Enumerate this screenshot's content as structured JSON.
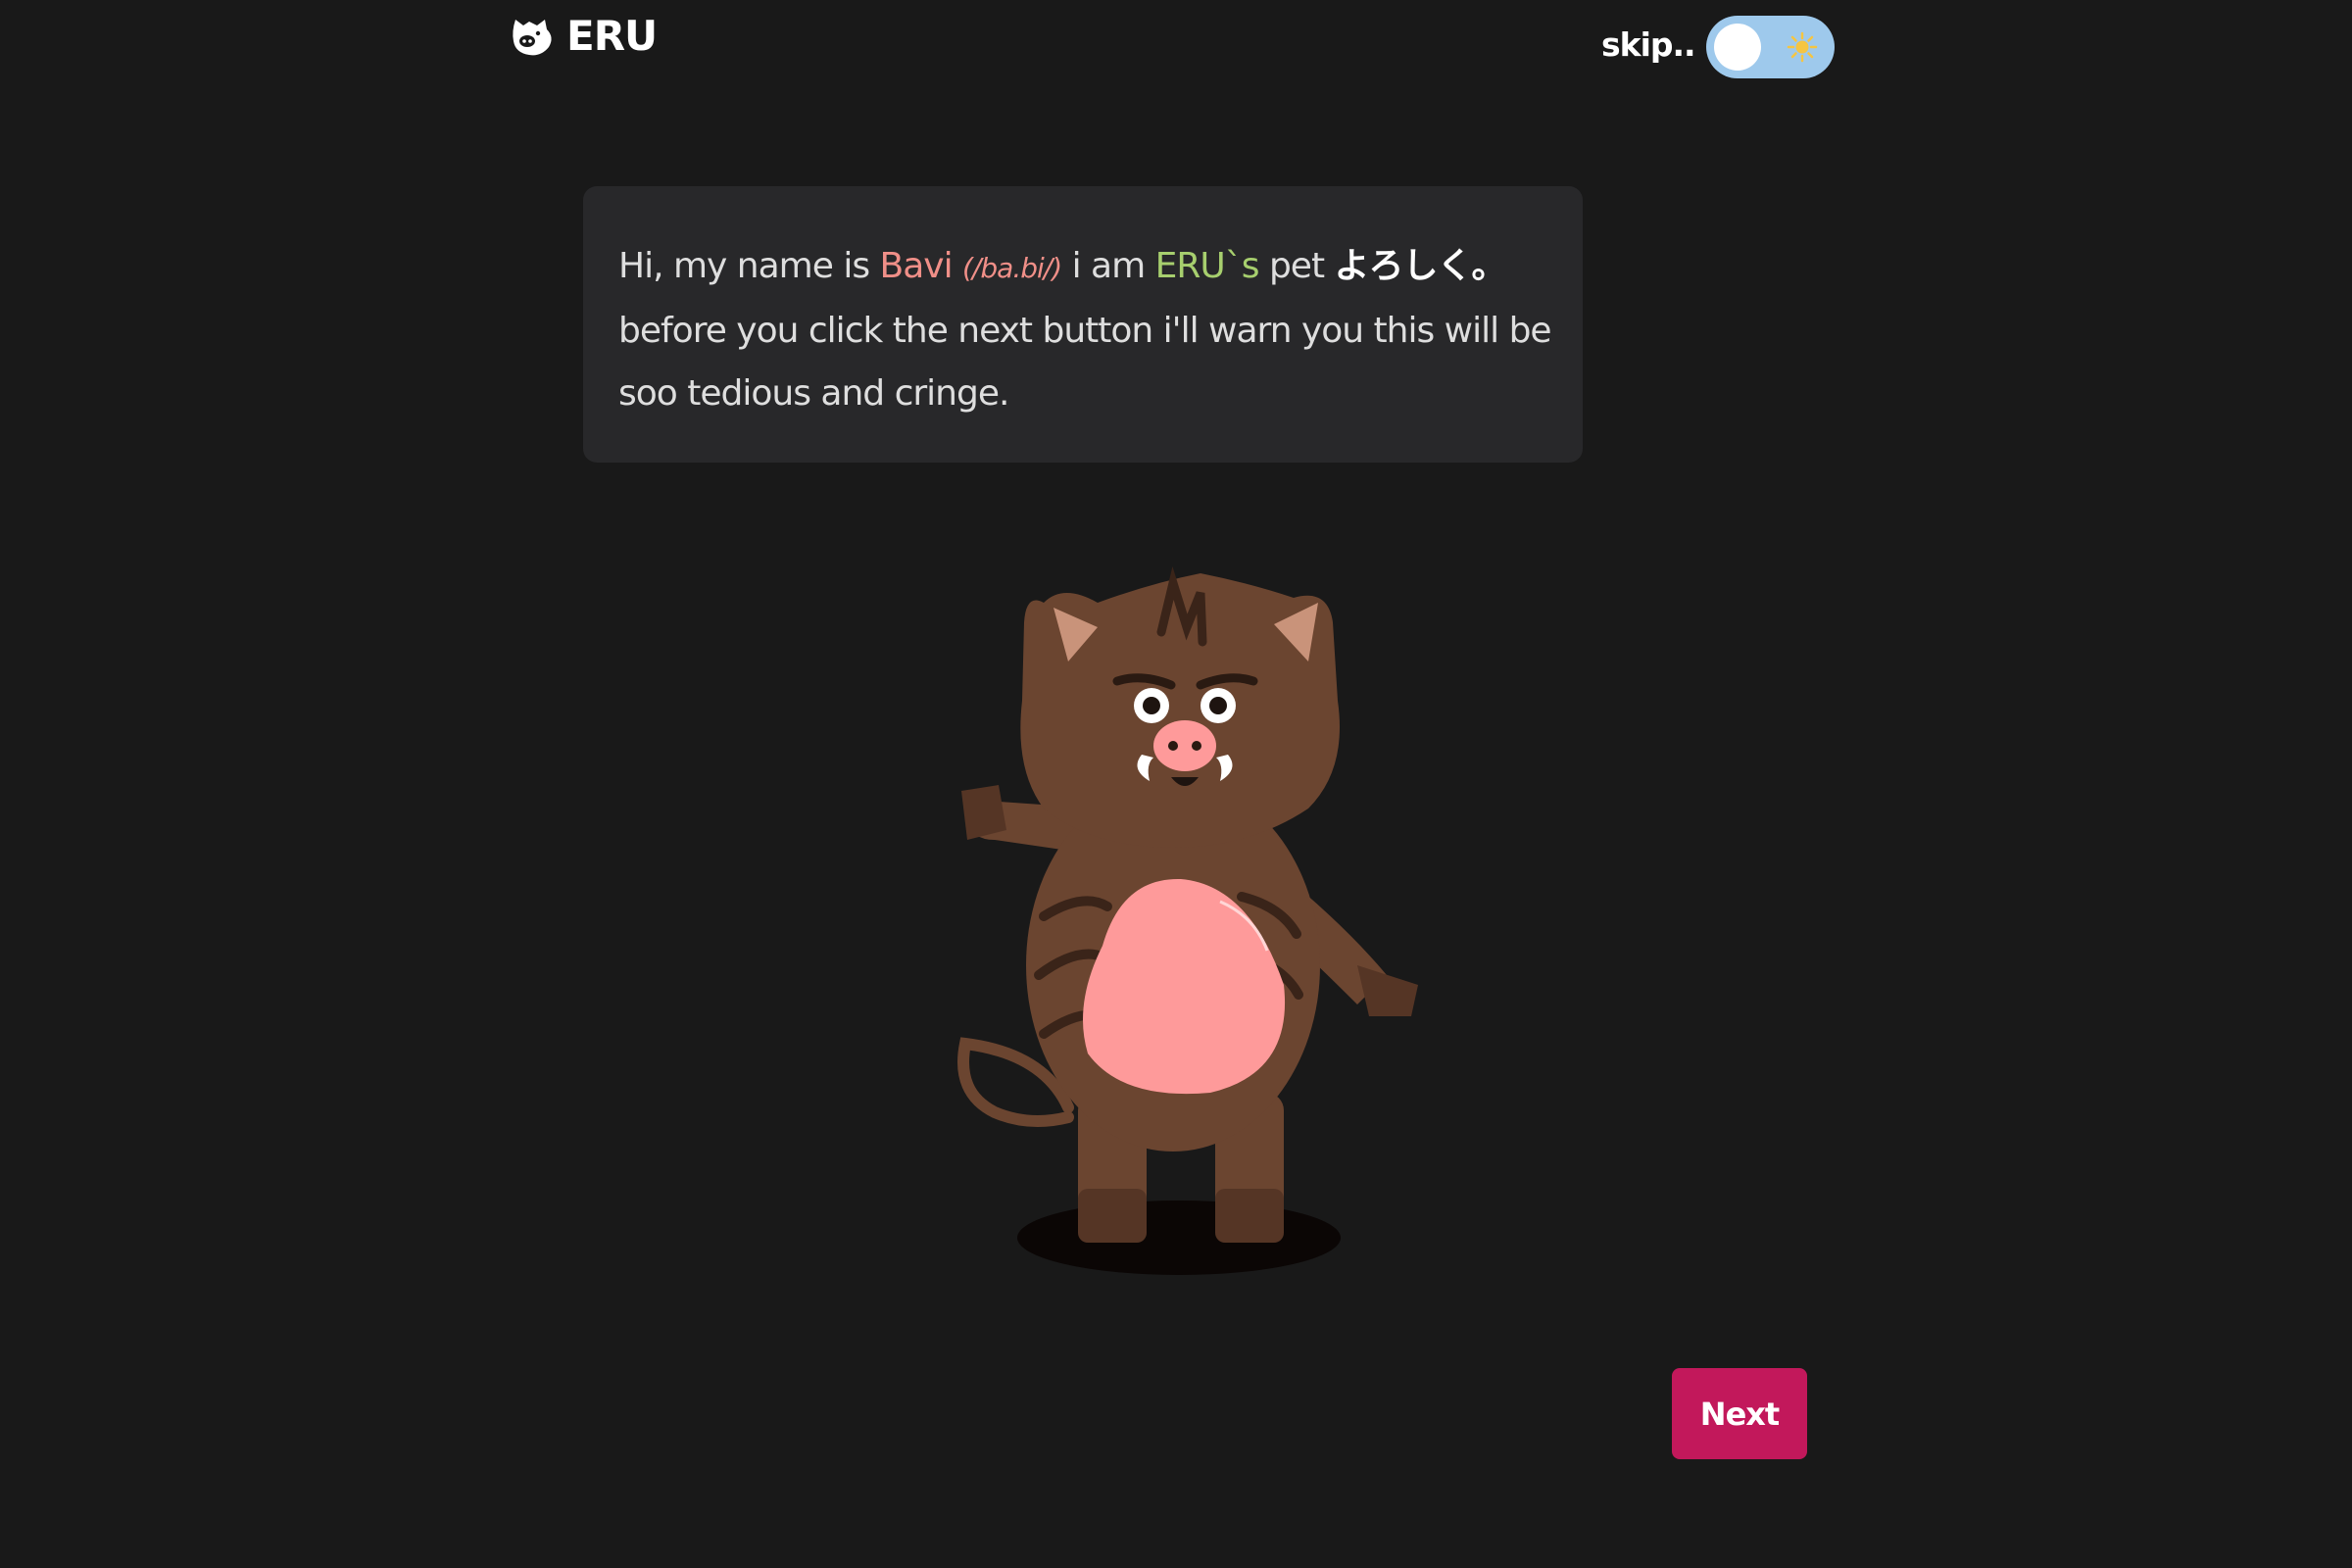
{
  "header": {
    "logo_text": "ERU",
    "logo_icon": "pig-face-icon",
    "skip_label": "skip..",
    "theme_toggle": {
      "state": "off",
      "icon": "sun-icon"
    }
  },
  "intro": {
    "prefix": "Hi, my name is ",
    "pet_name": "Bavi",
    "pronunciation": "(/ba.bi/)",
    "middle": " i am ",
    "owner": "ERU`s",
    "suffix": " pet ",
    "greeting_jp": "よろしく。",
    "line2": "before you click the next button i'll warn you this will be soo tedious and cringe."
  },
  "illustration": {
    "subject": "boar-mascot"
  },
  "actions": {
    "next_label": "Next"
  },
  "colors": {
    "background": "#191919",
    "card": "#28282a",
    "name_highlight": "#f08f88",
    "owner_highlight": "#a7cf6e",
    "next_button": "#c2185b",
    "toggle_track": "#9ec9ec"
  }
}
